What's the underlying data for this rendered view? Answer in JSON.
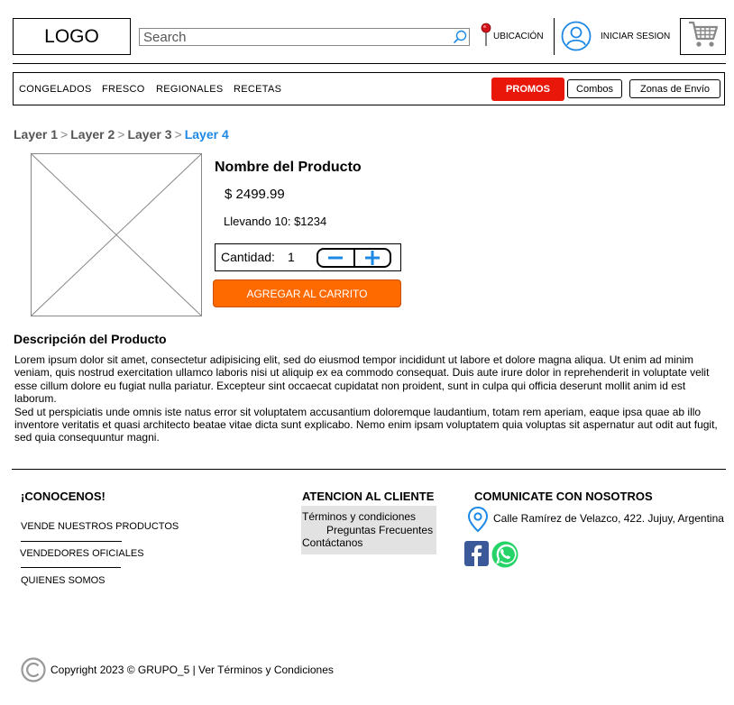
{
  "header": {
    "logo": "LOGO",
    "search_placeholder": "Search",
    "location_label": "UBICACIÓN",
    "login_label": "INICIAR SESION"
  },
  "nav": {
    "categories": [
      "CONGELADOS",
      "FRESCO",
      "REGIONALES",
      "RECETAS"
    ],
    "promos": "PROMOS",
    "combos": "Combos",
    "shipping": "Zonas de Envío"
  },
  "breadcrumb": [
    "Layer 1",
    "Layer 2",
    "Layer 3",
    "Layer 4"
  ],
  "breadcrumb_separator": ">",
  "product": {
    "name": "Nombre del Producto",
    "price": "$ 2499.99",
    "bulk_offer": "Llevando 10: $1234",
    "quantity_label": "Cantidad:",
    "quantity": "1",
    "add_to_cart": "AGREGAR AL CARRITO"
  },
  "description": {
    "title": "Descripción del Producto",
    "paragraph1": "Lorem ipsum dolor sit amet, consectetur adipisicing elit, sed do eiusmod tempor incididunt ut labore et dolore magna aliqua. Ut enim ad minim veniam, quis nostrud exercitation ullamco laboris nisi ut aliquip ex ea commodo consequat. Duis aute irure dolor in reprehenderit in voluptate velit esse cillum dolore eu fugiat nulla pariatur. Excepteur sint occaecat cupidatat non proident, sunt in culpa qui officia deserunt mollit anim id est laborum.",
    "paragraph2": "Sed ut perspiciatis unde omnis iste natus error sit voluptatem accusantium doloremque laudantium, totam rem aperiam, eaque ipsa quae ab illo inventore veritatis et quasi architecto beatae vitae dicta sunt explicabo. Nemo enim ipsam voluptatem quia voluptas sit aspernatur aut odit aut fugit, sed quia consequuntur magni."
  },
  "footer": {
    "about_title": "¡CONOCENOS!",
    "about_links": [
      "VENDE NUESTROS PRODUCTOS",
      "VENDEDORES OFICIALES",
      "QUIENES SOMOS"
    ],
    "support_title": "ATENCION AL CLIENTE",
    "support_links": [
      "Términos y condiciones",
      "Preguntas Frecuentes",
      "Contáctanos"
    ],
    "contact_title": "COMUNICATE CON NOSOTROS",
    "address": "Calle Ramírez de Velazco, 422. Jujuy, Argentina",
    "copyright": "Copyright 2023 © GRUPO_5  | Ver Términos y Condiciones"
  },
  "colors": {
    "promos": "#e8170a",
    "add_to_cart": "#ff6a00",
    "breadcrumb_current": "#1e88e5",
    "icon_blue": "#1e88e5"
  }
}
